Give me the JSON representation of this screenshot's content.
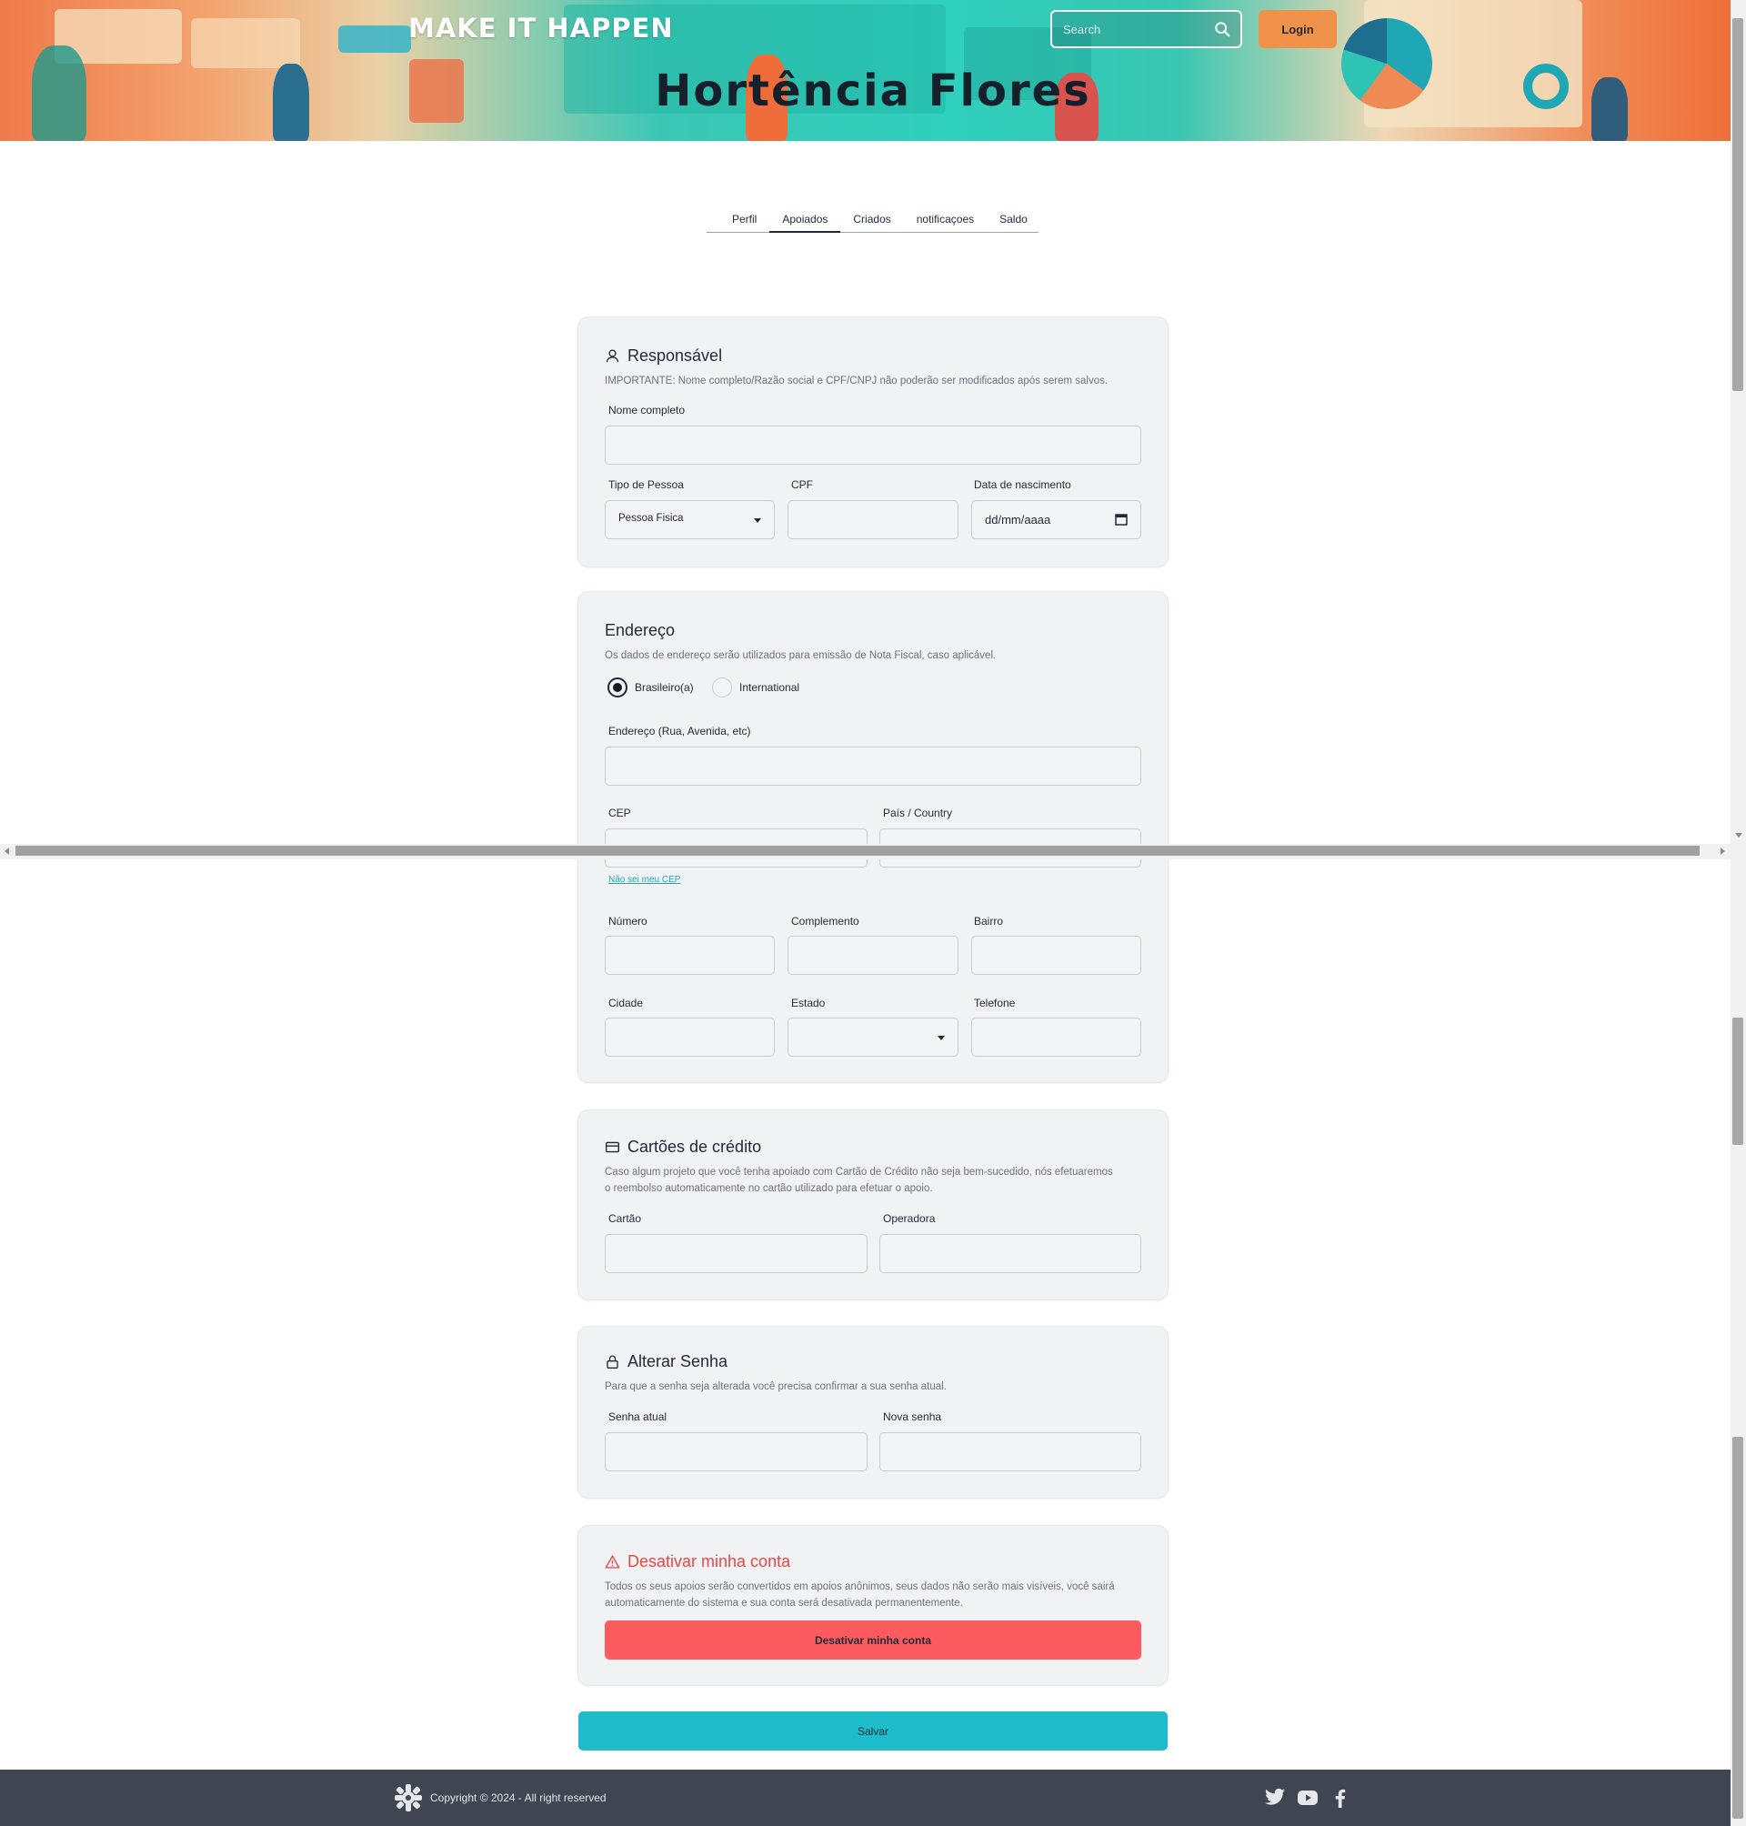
{
  "header": {
    "brand": "MAKE IT HAPPEN",
    "title": "Hortência Flores",
    "search_placeholder": "Search",
    "login_label": "Login"
  },
  "tabs": [
    {
      "label": "Perfil",
      "active": false
    },
    {
      "label": "Apoiados",
      "active": true
    },
    {
      "label": "Criados",
      "active": false
    },
    {
      "label": "notificaçoes",
      "active": false
    },
    {
      "label": "Saldo",
      "active": false
    }
  ],
  "responsavel": {
    "title": "Responsável",
    "icon": "user-icon",
    "description": "IMPORTANTE: Nome completo/Razão social e CPF/CNPJ não poderão ser modificados após serem salvos.",
    "nome_label": "Nome completo",
    "nome_value": "",
    "tipo_label": "Tipo de Pessoa",
    "tipo_value": "Pessoa Fisica",
    "cpf_label": "CPF",
    "cpf_value": "",
    "nascimento_label": "Data de nascimento",
    "nascimento_placeholder": "dd/mm/aaaa"
  },
  "endereco": {
    "title": "Endereço",
    "description": "Os dados de endereço serão utilizados para emissão de Nota Fiscal, caso aplicável.",
    "radio_brasileiro": "Brasileiro(a)",
    "radio_international": "International",
    "selected": "Brasileiro(a)",
    "rua_label": "Endereço (Rua, Avenida, etc)",
    "cep_label": "CEP",
    "pais_label": "País / Country",
    "nao_sei_cep": "Não sei meu CEP",
    "numero_label": "Número",
    "complemento_label": "Complemento",
    "bairro_label": "Bairro",
    "cidade_label": "Cidade",
    "estado_label": "Estado",
    "telefone_label": "Telefone"
  },
  "cartoes": {
    "title": "Cartões de crédito",
    "icon": "credit-card-icon",
    "description": "Caso algum projeto que você tenha apoiado com Cartão de Crédito não seja bem-sucedido, nós efetuaremos o reembolso automaticamente no cartão utilizado para efetuar o apoio.",
    "cartao_label": "Cartão",
    "operadora_label": "Operadora"
  },
  "senha": {
    "title": "Alterar Senha",
    "icon": "lock-icon",
    "description": "Para que a senha seja alterada você precisa confirmar a sua senha atual.",
    "atual_label": "Senha atual",
    "nova_label": "Nova senha"
  },
  "desativar": {
    "title": "Desativar minha conta",
    "icon": "warning-icon",
    "description": "Todos os seus apoios serão convertidos em apoios anônimos, seus dados não serão mais visíveis, você sairá automaticamente do sistema e sua conta será desativada permanentemente.",
    "button_label": "Desativar minha conta"
  },
  "save_label": "Salvar",
  "footer": {
    "copyright": "Copyright © 2024 - All right reserved",
    "logo_icon": "gear-logo-icon",
    "social": [
      "twitter-icon",
      "youtube-icon",
      "facebook-icon"
    ]
  },
  "colors": {
    "accent_orange": "#f1924a",
    "accent_teal": "#1fbccc",
    "danger": "#fb5b5f",
    "footer_bg": "#3f4551",
    "card_bg": "#f1f2f4"
  }
}
